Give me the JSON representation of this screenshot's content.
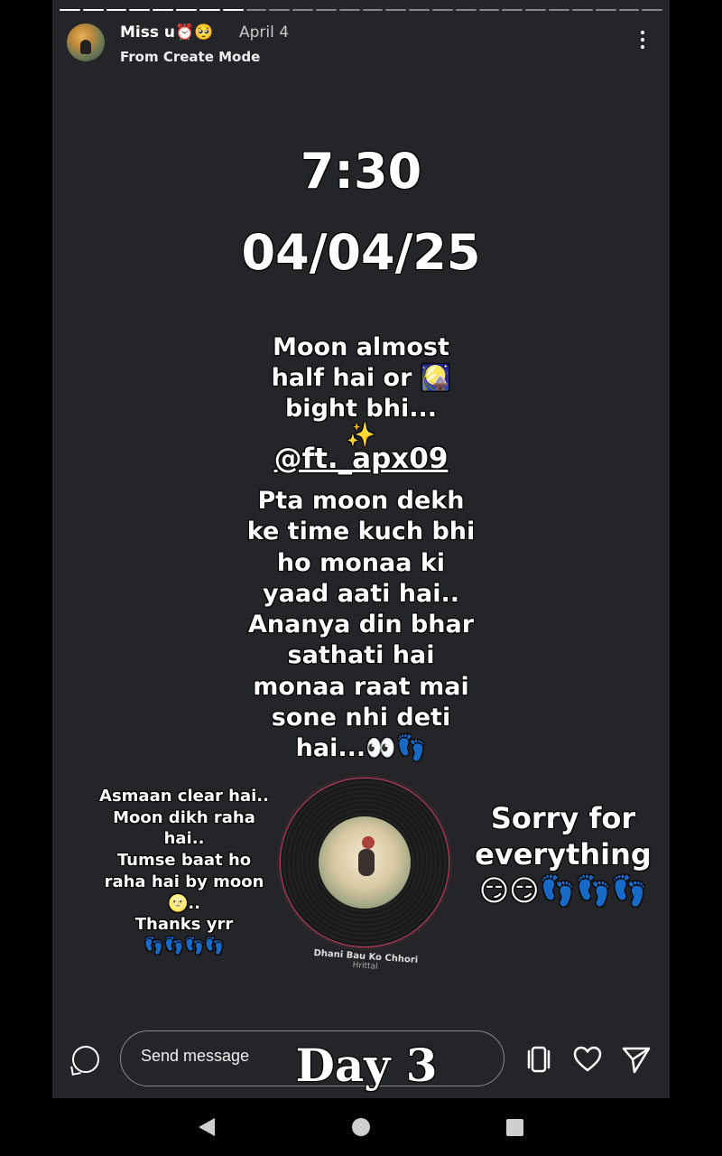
{
  "story": {
    "username": "Miss u⏰🥺",
    "date": "April 4",
    "source": "From Create Mode",
    "progress_segments_total": 26,
    "progress_segments_done": 8
  },
  "stickers": {
    "time": "7:30",
    "date": "04/04/25",
    "moon_line1": "Moon almost",
    "moon_line2": "half hai or 🎑",
    "moon_line3": "bight bhi...",
    "sparkle": "✨",
    "mention": "@ft._apx09",
    "pta_lines": [
      "Pta moon dekh",
      "ke time kuch bhi",
      "ho monaa ki",
      "yaad aati hai..",
      "Ananya din bhar",
      "sathati hai",
      "monaa raat mai",
      "sone nhi deti",
      "hai...👀👣"
    ],
    "left_lines": [
      "Asmaan clear hai..",
      "Moon dikh raha",
      "hai..",
      "Tumse baat ho",
      "raha hai by moon",
      "🌝..",
      "Thanks yrr",
      "👣👣👣👣"
    ],
    "right_lines": [
      "Sorry for",
      "everything",
      "😏😏👣👣👣"
    ],
    "day": "Day 3"
  },
  "music": {
    "title": "Dhani Bau Ko Chhori",
    "artist": "Hrittal"
  },
  "footer": {
    "message_placeholder": "Send message"
  },
  "icons": {
    "more": "more-vertical-icon",
    "chat": "chat-bubble-icon",
    "repost": "repost-icon",
    "like": "heart-icon",
    "send": "send-icon"
  }
}
